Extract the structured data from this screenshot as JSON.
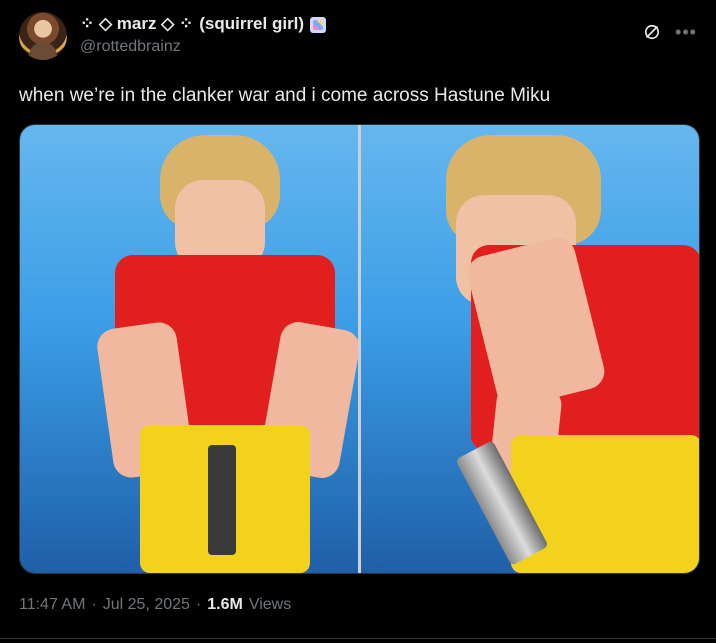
{
  "tweet": {
    "display_name_prefix": "⁘ ◇ marz ◇ ⁘",
    "display_name_suffix": "(squirrel girl)",
    "handle": "@rottedbrainz",
    "text": "when we’re in the clanker war and i come across Hastune Miku",
    "time": "11:47 AM",
    "date": "Jul 25, 2025",
    "views_count": "1.6M",
    "views_label": "Views"
  },
  "icons": {
    "grok": "grok-icon",
    "more": "more-icon"
  },
  "colors": {
    "background": "#000000",
    "text_primary": "#e7e9ea",
    "text_secondary": "#71767b",
    "border": "#2f3336"
  }
}
